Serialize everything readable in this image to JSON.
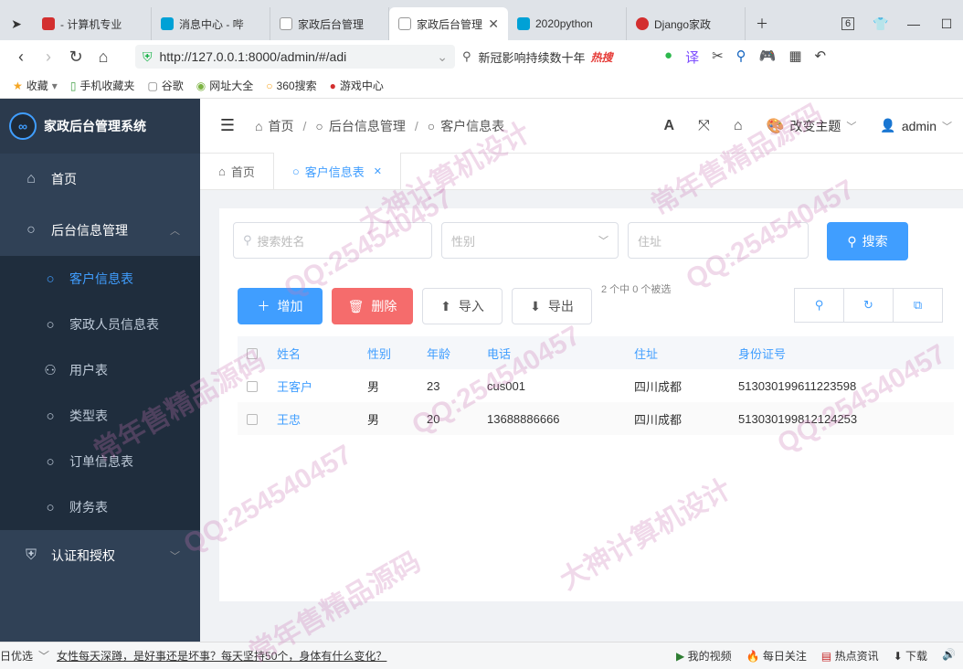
{
  "browser": {
    "tabs": [
      {
        "label": "- 计算机专业",
        "color": "#d32f2f",
        "active": false
      },
      {
        "label": "消息中心 - 哔",
        "color": "#00a1d6",
        "active": false
      },
      {
        "label": "家政后台管理",
        "color": "#9e9e9e",
        "active": false
      },
      {
        "label": "家政后台管理",
        "color": "#9e9e9e",
        "active": true
      },
      {
        "label": "2020python",
        "color": "#00a1d6",
        "active": false
      },
      {
        "label": "Django家政",
        "color": "#d32f2f",
        "active": false
      }
    ],
    "tab_count": "6",
    "url": "http://127.0.0.1:8000/admin/#/adi",
    "search_text": "新冠影响持续数十年",
    "search_hot": "热搜",
    "bookmarks": [
      "收藏",
      "手机收藏夹",
      "谷歌",
      "网址大全",
      "360搜索",
      "游戏中心"
    ]
  },
  "app": {
    "title": "家政后台管理系统",
    "header": {
      "breadcrumb": [
        "首页",
        "后台信息管理",
        "客户信息表"
      ],
      "theme_label": "改变主题",
      "user": "admin"
    },
    "tags": [
      {
        "label": "首页",
        "active": false
      },
      {
        "label": "客户信息表",
        "active": true
      }
    ],
    "sidebar": {
      "home": "首页",
      "group": "后台信息管理",
      "items": [
        "客户信息表",
        "家政人员信息表",
        "用户表",
        "类型表",
        "订单信息表",
        "财务表"
      ],
      "auth": "认证和授权"
    },
    "filters": {
      "name_placeholder": "搜索姓名",
      "gender_placeholder": "性别",
      "address_placeholder": "住址",
      "search_button": "搜索"
    },
    "actions": {
      "add": "增加",
      "delete": "删除",
      "import": "导入",
      "export": "导出",
      "selection_info": "2 个中 0 个被选"
    },
    "table": {
      "columns": [
        "姓名",
        "性别",
        "年龄",
        "电话",
        "住址",
        "身份证号"
      ],
      "rows": [
        [
          "王客户",
          "男",
          "23",
          "cus001",
          "四川成都",
          "513030199611223598"
        ],
        [
          "王忠",
          "男",
          "20",
          "13688886666",
          "四川成都",
          "513030199812124253"
        ]
      ]
    }
  },
  "statusbar": {
    "left": "日优选",
    "news": "女性每天深蹲，是好事还是坏事？每天坚持50个，身体有什么变化？",
    "items": [
      "我的视频",
      "每日关注",
      "热点资讯",
      "下载"
    ]
  },
  "watermarks": [
    "QQ:254540457",
    "大神计算机设计",
    "常年售精品源码"
  ]
}
